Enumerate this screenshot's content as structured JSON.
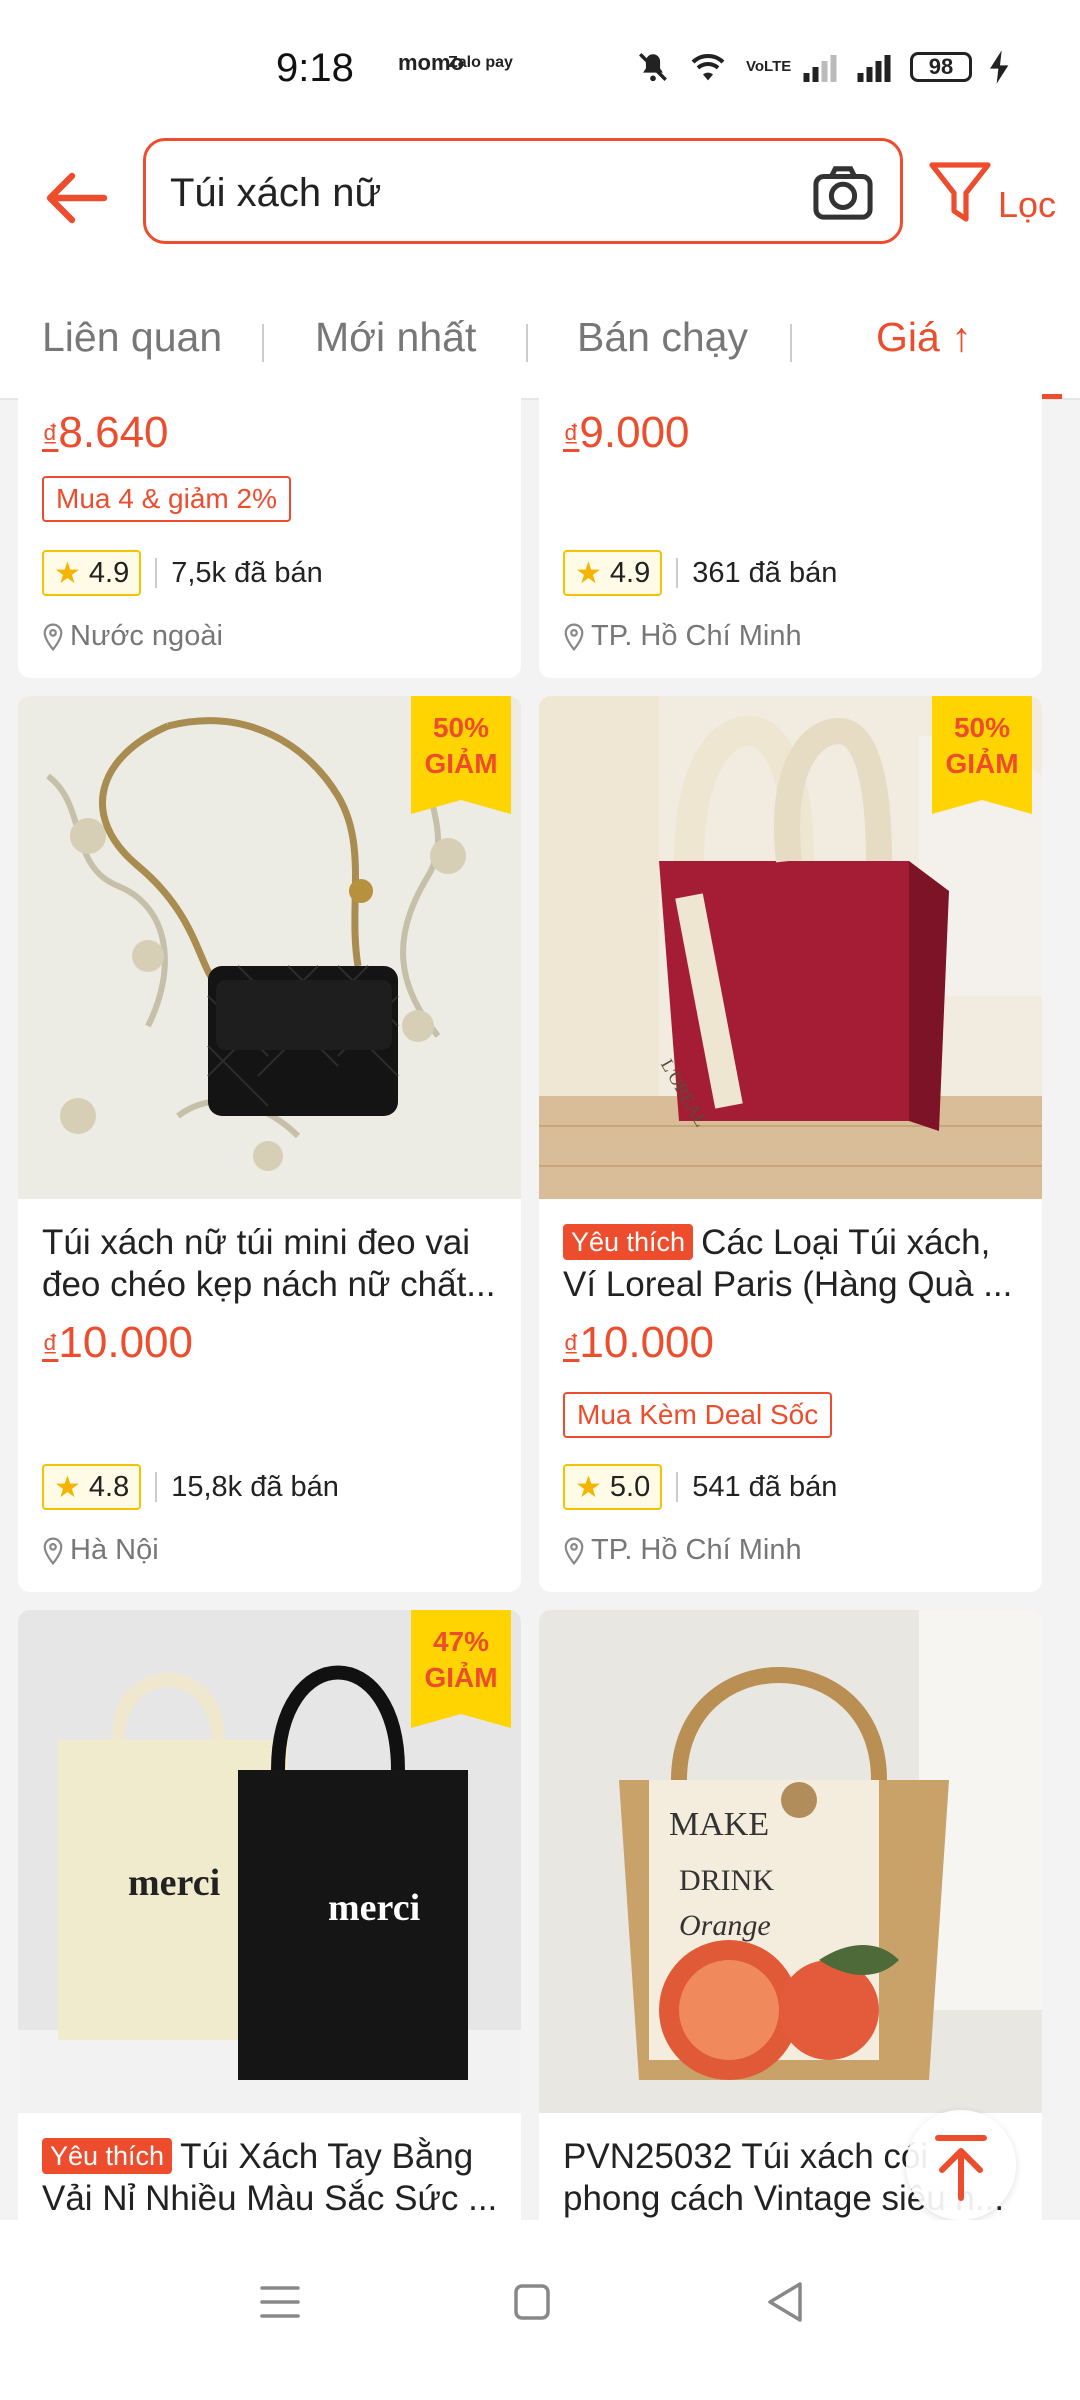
{
  "status_bar": {
    "time": "9:18",
    "app_icons": [
      "momo",
      "Zalo pay"
    ],
    "battery": "98",
    "network": "VoLTE"
  },
  "search": {
    "query": "Túi xách nữ",
    "filter_label": "Lọc"
  },
  "sort_tabs": [
    {
      "label": "Liên quan",
      "active": false
    },
    {
      "label": "Mới nhất",
      "active": false
    },
    {
      "label": "Bán chạy",
      "active": false
    },
    {
      "label": "Giá ↑",
      "active": true
    }
  ],
  "products": [
    {
      "price": "8.640",
      "currency": "₫",
      "promo": "Mua 4 & giảm 2%",
      "rating": "4.9",
      "sold": "7,5k đã bán",
      "location": "Nước ngoài"
    },
    {
      "price": "9.000",
      "currency": "₫",
      "rating": "4.9",
      "sold": "361 đã bán",
      "location": "TP. Hồ Chí Minh"
    },
    {
      "discount_line1": "50%",
      "discount_line2": "GIẢM",
      "title_line1": "Túi xách nữ túi mini đeo vai",
      "title_line2": "đeo chéo kẹp nách nữ chất...",
      "price": "10.000",
      "currency": "₫",
      "rating": "4.8",
      "sold": "15,8k đã bán",
      "location": "Hà Nội"
    },
    {
      "discount_line1": "50%",
      "discount_line2": "GIẢM",
      "tag": "Yêu thích",
      "title_line1": "Các Loại Túi xách,",
      "title_line2": "Ví Loreal Paris (Hàng Quà ...",
      "price": "10.000",
      "currency": "₫",
      "promo": "Mua Kèm Deal Sốc",
      "rating": "5.0",
      "sold": "541 đã bán",
      "location": "TP. Hồ Chí Minh"
    },
    {
      "discount_line1": "47%",
      "discount_line2": "GIẢM",
      "tag": "Yêu thích",
      "title_line1": "Túi Xách Tay Bằng",
      "title_line2": "Vải Nỉ Nhiều Màu Sắc Sức ..."
    },
    {
      "title_line1": "PVN25032 Túi xách cói",
      "title_line2": "phong cách Vintage siêu h..."
    }
  ],
  "colors": {
    "accent": "#ee4d2d",
    "discount_bg": "#ffd400",
    "rating_border": "#f5c200"
  }
}
